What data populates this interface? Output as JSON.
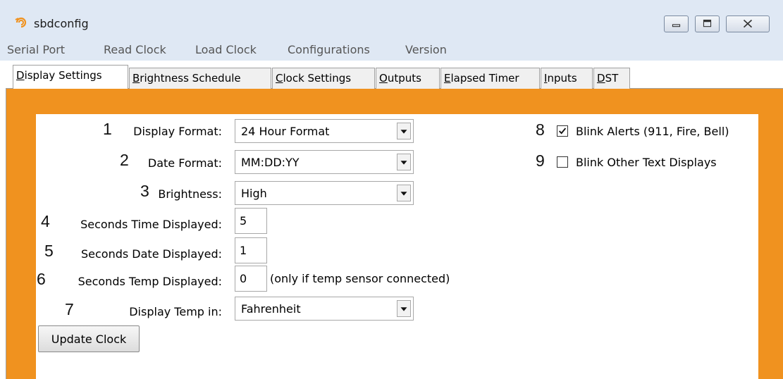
{
  "window": {
    "title": "sbdconfig",
    "icon": "swirl-app-icon",
    "controls": [
      "minimize-icon",
      "maximize-icon",
      "close-icon"
    ]
  },
  "menu": [
    "Serial Port",
    "Read Clock",
    "Load Clock",
    "Configurations",
    "Version"
  ],
  "tabs": [
    {
      "first": "D",
      "rest": "isplay Settings",
      "active": true
    },
    {
      "first": "B",
      "rest": "rightness Schedule",
      "active": false
    },
    {
      "first": "C",
      "rest": "lock Settings",
      "active": false
    },
    {
      "first": "O",
      "rest": "utputs",
      "active": false
    },
    {
      "first": "E",
      "rest": "lapsed Timer",
      "active": false
    },
    {
      "first": "I",
      "rest": "nputs",
      "active": false
    },
    {
      "first": "D",
      "rest": "ST",
      "active": false
    }
  ],
  "colors": {
    "frame": "#f0921f",
    "title_bar": "#dfe8f4"
  },
  "fields": {
    "display_format": {
      "number": "1",
      "label": "Display Format:",
      "value": "24 Hour Format"
    },
    "date_format": {
      "number": "2",
      "label": "Date Format:",
      "value": "MM:DD:YY"
    },
    "brightness": {
      "number": "3",
      "label": "Brightness:",
      "value": "High"
    },
    "seconds_time": {
      "number": "4",
      "label": "Seconds Time Displayed:",
      "value": "5"
    },
    "seconds_date": {
      "number": "5",
      "label": "Seconds Date Displayed:",
      "value": "1"
    },
    "seconds_temp": {
      "number": "6",
      "label": "Seconds Temp Displayed:",
      "value": "0",
      "note": "(only if temp sensor connected)"
    },
    "temp_unit": {
      "number": "7",
      "label": "Display Temp in:",
      "value": "Fahrenheit"
    }
  },
  "checkboxes": {
    "blink_alerts": {
      "number": "8",
      "label": "Blink Alerts (911, Fire, Bell)",
      "checked": true
    },
    "blink_other": {
      "number": "9",
      "label": "Blink Other Text Displays",
      "checked": false
    }
  },
  "buttons": {
    "update": "Update Clock"
  }
}
